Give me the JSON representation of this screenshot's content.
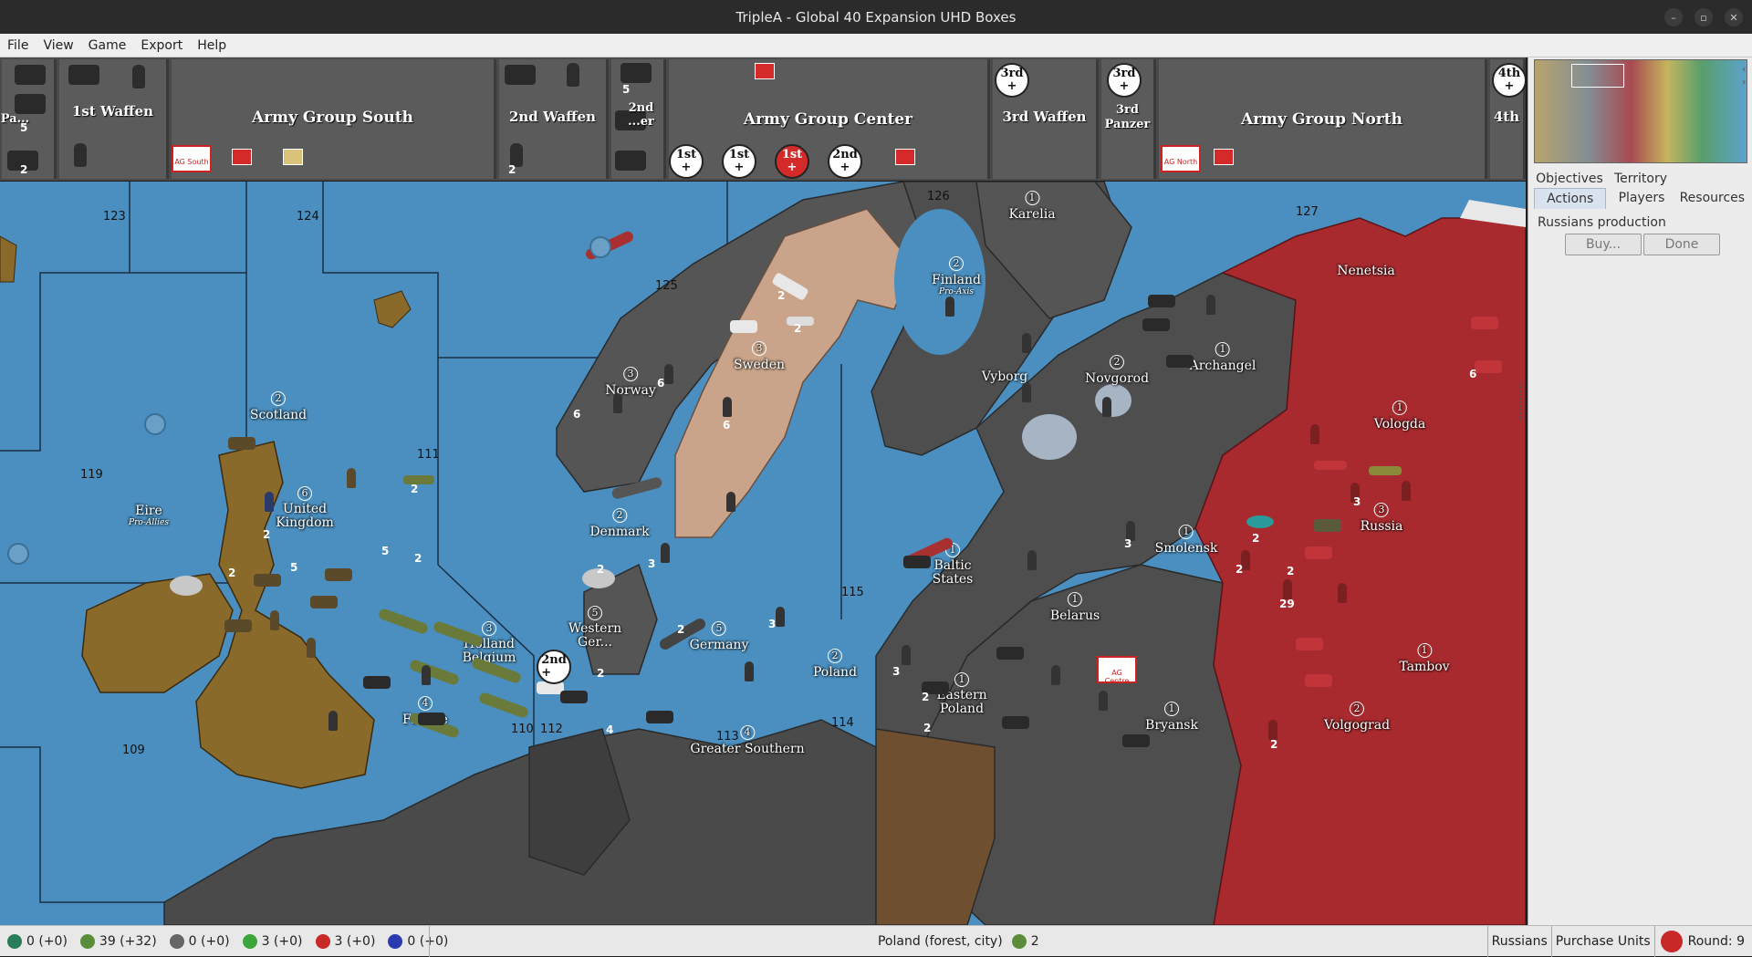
{
  "window": {
    "title": "TripleA - Global 40 Expansion UHD Boxes"
  },
  "menu": [
    "File",
    "View",
    "Game",
    "Export",
    "Help"
  ],
  "unit_bar": {
    "groups": [
      {
        "label": "Pa...",
        "count1": "5",
        "count2": "2"
      },
      {
        "label": "1st Waffen"
      },
      {
        "label": "Army Group South",
        "flag_label": "AG South"
      },
      {
        "label": "2nd Waffen",
        "count": "2"
      },
      {
        "label": "2nd ...er",
        "count": "5"
      },
      {
        "label": "Army Group Center"
      },
      {
        "label": "3rd Waffen"
      },
      {
        "label": "3rd Panzer"
      },
      {
        "label": "Army Group North",
        "flag_label": "AG North"
      },
      {
        "label": "4th"
      }
    ],
    "badges": {
      "third_waffen": "3rd",
      "third_panzer": "3rd",
      "fourth": "4th",
      "first_a": "1st",
      "first_b": "1st",
      "first_c": "1st",
      "second": "2nd"
    }
  },
  "map": {
    "sea_zones": [
      "123",
      "124",
      "125",
      "126",
      "127",
      "119",
      "111",
      "110",
      "112",
      "113",
      "114",
      "115",
      "109"
    ],
    "territories": [
      {
        "name": "Karelia",
        "pv": "1"
      },
      {
        "name": "Finland",
        "pv": "2",
        "sub": "Pro-Axis"
      },
      {
        "name": "Nenetsia",
        "pv": ""
      },
      {
        "name": "Sweden",
        "pv": "3"
      },
      {
        "name": "Norway",
        "pv": "3"
      },
      {
        "name": "Vyborg",
        "pv": ""
      },
      {
        "name": "Novgorod",
        "pv": "2"
      },
      {
        "name": "Archangel",
        "pv": "1"
      },
      {
        "name": "Vologda",
        "pv": "1"
      },
      {
        "name": "Scotland",
        "pv": "2"
      },
      {
        "name": "Eire",
        "pv": "",
        "sub": "Pro-Allies"
      },
      {
        "name": "United Kingdom",
        "pv": "6"
      },
      {
        "name": "Denmark",
        "pv": "2"
      },
      {
        "name": "Russia",
        "pv": "3"
      },
      {
        "name": "Smolensk",
        "pv": "1"
      },
      {
        "name": "Baltic States",
        "pv": "1"
      },
      {
        "name": "Belarus",
        "pv": "1"
      },
      {
        "name": "Western Ger...",
        "pv": "5"
      },
      {
        "name": "Germany",
        "pv": "5"
      },
      {
        "name": "Holland Belgium",
        "pv": "3"
      },
      {
        "name": "Poland",
        "pv": "2"
      },
      {
        "name": "Eastern Poland",
        "pv": "1"
      },
      {
        "name": "Tambov",
        "pv": "1"
      },
      {
        "name": "France",
        "pv": "4"
      },
      {
        "name": "Bryansk",
        "pv": "1"
      },
      {
        "name": "Volgograd",
        "pv": "2"
      },
      {
        "name": "Greater Southern",
        "pv": "4"
      }
    ],
    "unit_counts": [
      "2",
      "2",
      "6",
      "6",
      "6",
      "2",
      "5",
      "2",
      "5",
      "2",
      "3",
      "2",
      "2",
      "3",
      "2",
      "3",
      "2",
      "2",
      "29",
      "6",
      "3",
      "2",
      "2",
      "2",
      "4",
      "3",
      "2",
      "2"
    ],
    "flag_labels": {
      "ag_centre": "AG Centre"
    }
  },
  "side_panel": {
    "tabs_row1": [
      "Objectives",
      "Territory"
    ],
    "tabs_row2": [
      "Actions",
      "Players",
      "Resources"
    ],
    "active_tab": "Actions",
    "production_label": "Russians production",
    "buy_button": "Buy...",
    "done_button": "Done"
  },
  "status_bar": {
    "resources": [
      {
        "icon": "pu-icon",
        "value": "0 (+0)",
        "color": "#2a7d5a"
      },
      {
        "icon": "money-icon",
        "value": "39 (+32)",
        "color": "#5a8d3a"
      },
      {
        "icon": "tech-icon",
        "value": "0 (+0)",
        "color": "#666666"
      },
      {
        "icon": "air-ll-icon",
        "value": "3 (+0)",
        "color": "#3ca63c"
      },
      {
        "icon": "tank-ll-icon",
        "value": "3 (+0)",
        "color": "#c82828"
      },
      {
        "icon": "navy-ll-icon",
        "value": "0 (+0)",
        "color": "#2a3cb0"
      }
    ],
    "territory_info": "Poland (forest, city)",
    "territory_value": "2",
    "player": "Russians",
    "phase": "Purchase Units",
    "round": "Round: 9"
  },
  "colors": {
    "sea": "#4a8fbf",
    "axis_gray": "#4e4e4e",
    "russia_red": "#a82a2e",
    "uk_brown": "#8a6a2a",
    "neutral_tan": "#c9a48a",
    "germany_dark": "#3e3e3e"
  }
}
